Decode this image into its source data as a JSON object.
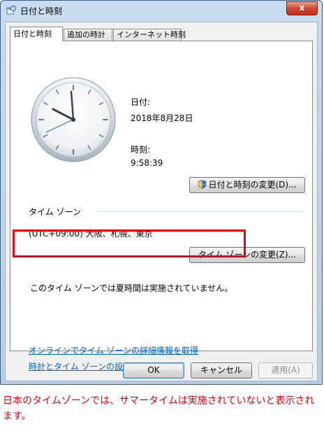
{
  "window": {
    "title": "日付と時刻",
    "close_label": "x"
  },
  "tabs": [
    {
      "label": "日付と時刻"
    },
    {
      "label": "追加の時計"
    },
    {
      "label": "インターネット時刻"
    }
  ],
  "date": {
    "label": "日付:",
    "value": "2018年8月28日"
  },
  "time": {
    "label": "時刻:",
    "value": "9:58:39"
  },
  "change_datetime_button": "日付と時刻の変更(D)...",
  "timezone": {
    "section_label": "タイム ゾーン",
    "value": "(UTC+09:00) 大阪、札幌、東京",
    "change_button": "タイム ゾーンの変更(Z)..."
  },
  "dst_notice": "このタイム ゾーンでは夏時間は実施されていません。",
  "links": [
    {
      "label": "オンラインでタイム ゾーンの詳細情報を取得"
    },
    {
      "label": "時計とタイム ゾーンの設定方法"
    }
  ],
  "footer": {
    "ok": "OK",
    "cancel": "キャンセル",
    "apply": "適用(A)"
  },
  "caption": "日本のタイムゾーンでは、サマータイムは実施されていないと表示されます。",
  "colors": {
    "highlight": "#e60012",
    "link": "#0066cc"
  }
}
